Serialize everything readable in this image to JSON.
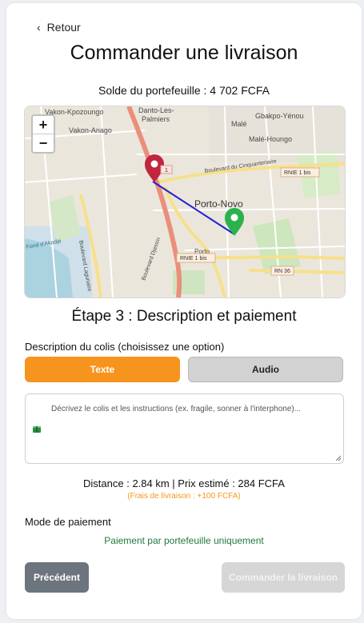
{
  "nav": {
    "back_label": "Retour"
  },
  "header": {
    "title": "Commander une livraison",
    "balance": "Solde du portefeuille : 4 702 FCFA"
  },
  "map": {
    "zoom_in": "+",
    "zoom_out": "−",
    "labels": {
      "vakon_kpozoungo": "Vakon-Kpozoungo",
      "danto_les": "Danto-Les-",
      "palmiers": "Palmiers",
      "gbakpo": "Gbakpo-Yénou",
      "male": "Malé",
      "male_houngo": "Malé-Houngo",
      "vakon_anago": "Vakon-Anago",
      "cinquantenaire": "Boulevard du Cinquantenaire",
      "rnie1": "1",
      "rnie1bis": "RNIE 1 bis",
      "porto_novo": "Porto-Novo",
      "porto_small": "Porto",
      "rnie1_bottom": "RNIE 1 bis",
      "rn36": "RN 36",
      "fond": "Fond d'Akodjé",
      "lagune": "Boulevard Lagunaire",
      "djassin": "Boulevard Djassin"
    },
    "colors": {
      "origin_pin": "#c0263e",
      "destination_pin": "#2bb24c",
      "route": "#1f1fd6"
    }
  },
  "step": {
    "title": "Étape 3 : Description et paiement"
  },
  "description": {
    "label": "Description du colis (choisissez une option)",
    "option_text": "Texte",
    "option_audio": "Audio",
    "placeholder": "Décrivez le colis et les instructions (ex. fragile, sonner à l'interphone)..."
  },
  "summary": {
    "distance_price": "Distance : 2.84 km | Prix estimé : 284 FCFA",
    "fee_note": "(Frais de livraison : +100 FCFA)"
  },
  "payment": {
    "label": "Mode de paiement",
    "wallet_only": "Paiement par portefeuille uniquement"
  },
  "actions": {
    "previous": "Précédent",
    "order": "Commander la livraison"
  },
  "colors": {
    "accent": "#f7941d",
    "secondary": "#6c757d",
    "success_text": "#1f7a3f"
  }
}
